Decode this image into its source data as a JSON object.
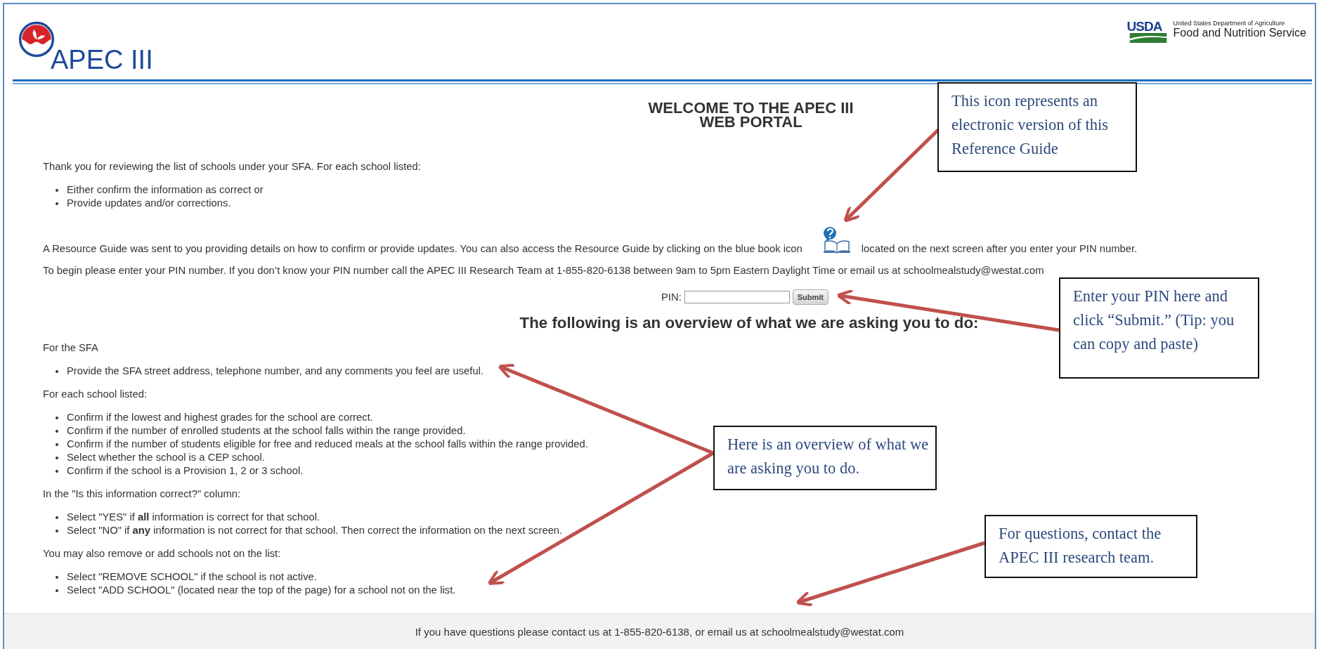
{
  "header": {
    "logo_text": "APEC III",
    "agency_mark": "USDA",
    "agency_department": "United States Department of Agriculture",
    "agency_service": "Food and Nutrition Service"
  },
  "welcome_title": [
    "WELCOME TO THE APEC III",
    "WEB PORTAL"
  ],
  "intro": "Thank you for reviewing the list of schools under your SFA. For each school listed:",
  "intro_items": [
    "Either confirm the information as correct or",
    "Provide updates and/or corrections."
  ],
  "resource_text_before": "A Resource Guide was sent to you providing details on how to confirm or provide updates. You can also access the Resource Guide by clicking on the blue book icon",
  "resource_text_after": "located on the next screen after you enter your PIN number.",
  "begin_text": "To begin please enter your PIN number. If you don’t know your PIN number call the APEC III Research Team at 1-855-820-6138 between 9am to 5pm Eastern Daylight Time or email us at schoolmealstudy@westat.com",
  "pin": {
    "label": "PIN:",
    "button": "Submit"
  },
  "overview_heading": "The following is an overview of what we are asking you to do:",
  "sections": [
    {
      "heading": "For the SFA",
      "items": [
        "Provide the SFA street address, telephone number, and any comments you feel are useful."
      ]
    },
    {
      "heading": "For each school listed:",
      "items": [
        "Confirm if the lowest and highest grades for the school are correct.",
        "Confirm if the number of enrolled students at the school falls within the range provided.",
        "Confirm if the number of students eligible for free and reduced meals at the school falls within the range provided.",
        "Select whether the school is a CEP school.",
        "Confirm if the school is a Provision 1, 2 or 3 school."
      ]
    },
    {
      "heading": "In the \"Is this information correct?\" column:",
      "items": [
        "Select \"YES\" if **all** information is correct for that school.",
        "Select \"NO\" if **any** information is not correct for that school. Then correct the information on the next screen."
      ]
    },
    {
      "heading": "You may also remove or add schools not on the list:",
      "items": [
        "Select \"REMOVE SCHOOL\" if the school is not active.",
        "Select \"ADD SCHOOL\" (located near the top of the page) for a school not on the list."
      ]
    }
  ],
  "footer": "If you have questions please contact us at 1-855-820-6138, or email us at schoolmealstudy@westat.com",
  "callouts": [
    {
      "text": "This icon represents an electronic version of this Reference Guide"
    },
    {
      "text": "Enter your PIN here and click “Submit.” (Tip: you can copy and paste)"
    },
    {
      "text": "Here is an overview of what we are asking you to do."
    },
    {
      "text": "For questions, contact the APEC III research team."
    }
  ]
}
